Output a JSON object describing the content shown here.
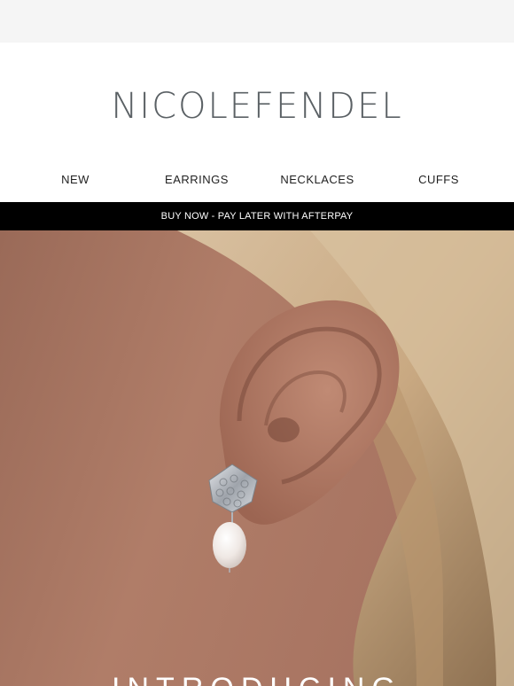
{
  "brand": {
    "logo_text": "NICOLEFENDEL"
  },
  "nav": {
    "items": [
      {
        "label": "NEW"
      },
      {
        "label": "EARRINGS"
      },
      {
        "label": "NECKLACES"
      },
      {
        "label": "CUFFS"
      }
    ]
  },
  "promo_banner": {
    "text": "BUY NOW - PAY LATER WITH AFTERPAY"
  },
  "hero": {
    "title": "INTRODUCING"
  },
  "colors": {
    "logo": "#5b6165",
    "banner_bg": "#000000",
    "banner_text": "#ffffff",
    "top_strip": "#f5f5f5"
  }
}
